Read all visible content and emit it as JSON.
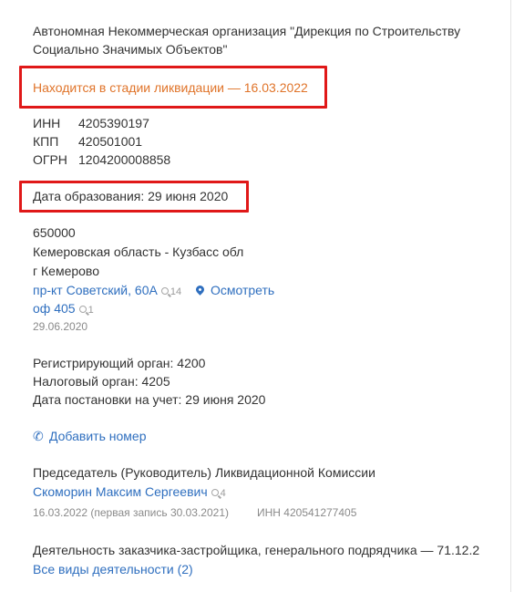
{
  "company": {
    "name_line1": "Автономная Некоммерческая организация \"Дирекция по Строительству",
    "name_line2": "Социально Значимых Объектов\"",
    "status": "Находится в стадии ликвидации — 16.03.2022"
  },
  "codes": [
    {
      "label": "ИНН",
      "value": "4205390197"
    },
    {
      "label": "КПП",
      "value": "420501001"
    },
    {
      "label": "ОГРН",
      "value": "1204200008858"
    }
  ],
  "formation": "Дата образования: 29 июня 2020",
  "address": {
    "zip": "650000",
    "region": "Кемеровская область - Кузбасс обл",
    "city": "г Кемерово",
    "street": "пр-кт Советский, 60А",
    "street_count": "14",
    "view_label": "Осмотреть",
    "office": "оф 405",
    "office_count": "1",
    "date": "29.06.2020"
  },
  "registration": {
    "reg_authority": "Регистрирующий орган: 4200",
    "tax_authority": "Налоговый орган: 4205",
    "registered_date": "Дата постановки на учет: 29 июня 2020"
  },
  "phone": {
    "add_label": "Добавить номер"
  },
  "head": {
    "role": "Председатель (Руководитель) Ликвидационной Комиссии",
    "name": "Скоморин Максим Сергеевич",
    "name_count": "4",
    "dates": "16.03.2022 (первая запись 30.03.2021)",
    "inn": "ИНН 420541277405"
  },
  "activity": {
    "main": "Деятельность заказчика-застройщика, генерального подрядчика — 71.12.2",
    "all_link": "Все виды деятельности (2)"
  },
  "colors": {
    "link": "#2f6fbf",
    "status": "#e0742a",
    "highlight": "#e01818"
  }
}
